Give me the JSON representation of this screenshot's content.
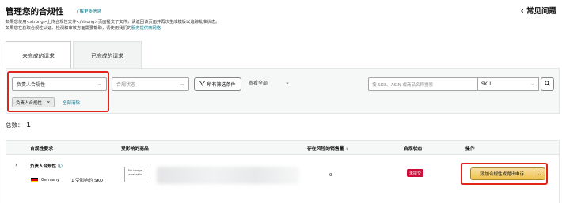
{
  "header": {
    "title": "管理您的合规性",
    "learn_more": "了解更多信息",
    "line1": "如果您使用<strong>上传合规性文件</strong>页面提交了文件，请返回该页面并再次生成模板以追踪批准状态。",
    "line2_prefix": "如果您在获取合规性认证、检测和审核方面需要帮助，请使用我们的",
    "line2_link": "服务提供商网络",
    "faq": "常见问题"
  },
  "tabs": [
    {
      "label": "未完成的请求",
      "active": true
    },
    {
      "label": "已完成的请求",
      "active": false
    }
  ],
  "filters": {
    "responsible_select": "负责人合规性",
    "status_placeholder": "合规状态",
    "all_filters": "所有筛选条件",
    "view_all": "查看全部",
    "search_placeholder": "按 SKU、ASIN 或商品名称搜索",
    "search_type": "SKU",
    "chip": "负责人合规性",
    "chip_remove": "×",
    "clear_all": "全部清除"
  },
  "total": {
    "label": "总数：",
    "value": "1"
  },
  "table": {
    "headers": {
      "requirement": "合规性要求",
      "affected": "受影响的商品",
      "at_risk": "存在风险的销售量",
      "sort_arrow": "↓",
      "status": "合规状态",
      "action": "操作"
    },
    "row": {
      "requirement": "负责人合规性",
      "info": "ⓘ",
      "country": "Germany",
      "affected_sku": "1 受影响的 SKU",
      "no_image": "No image available",
      "at_risk": "0",
      "status_badge": "未提交",
      "action_button": "添加合规性或提出申诉"
    }
  },
  "colors": {
    "link": "#007185",
    "highlight": "#e1251b",
    "badge": "#cc0c39"
  }
}
